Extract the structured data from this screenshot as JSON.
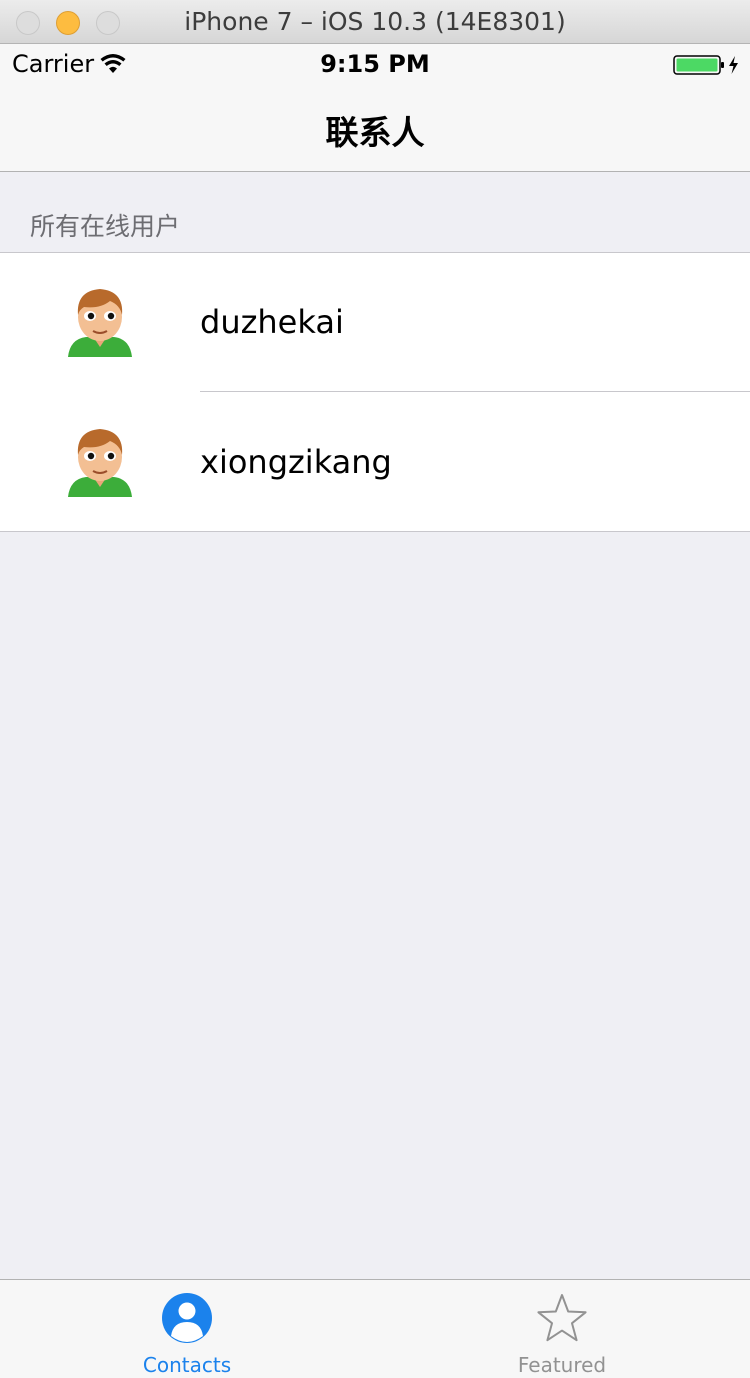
{
  "window": {
    "title": "iPhone 7 – iOS 10.3 (14E8301)"
  },
  "status_bar": {
    "carrier": "Carrier",
    "time": "9:15 PM",
    "wifi_icon": "wifi-icon",
    "battery_icon": "battery-charging-icon",
    "battery_color": "#4cd964"
  },
  "nav_bar": {
    "title": "联系人"
  },
  "section": {
    "header": "所有在线用户"
  },
  "contacts": [
    {
      "name": "duzhekai",
      "avatar_icon": "man-emoji-avatar"
    },
    {
      "name": "xiongzikang",
      "avatar_icon": "man-emoji-avatar"
    }
  ],
  "tab_bar": {
    "tabs": [
      {
        "label": "Contacts",
        "icon": "contacts-icon",
        "selected": true,
        "color": "#1b82ec"
      },
      {
        "label": "Featured",
        "icon": "star-icon",
        "selected": false,
        "color": "#929292"
      }
    ]
  }
}
